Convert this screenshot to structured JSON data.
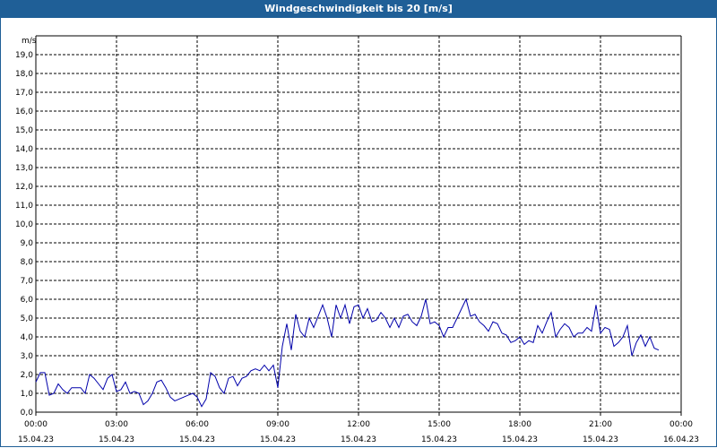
{
  "window": {
    "title": "Windgeschwindigkeit bis 20 [m/s]"
  },
  "chart_data": {
    "type": "line",
    "title": "Windgeschwindigkeit bis 20 [m/s]",
    "ylabel": "m/s",
    "ylim": [
      0,
      20
    ],
    "yticks": [
      "0,0",
      "1,0",
      "2,0",
      "3,0",
      "4,0",
      "5,0",
      "6,0",
      "7,0",
      "8,0",
      "9,0",
      "10,0",
      "11,0",
      "12,0",
      "13,0",
      "14,0",
      "15,0",
      "16,0",
      "17,0",
      "18,0",
      "19,0"
    ],
    "xlim": [
      "2023-04-15 00:00",
      "2023-04-16 00:00"
    ],
    "xticks": [
      {
        "time": "00:00",
        "date": "15.04.23"
      },
      {
        "time": "03:00",
        "date": "15.04.23"
      },
      {
        "time": "06:00",
        "date": "15.04.23"
      },
      {
        "time": "09:00",
        "date": "15.04.23"
      },
      {
        "time": "12:00",
        "date": "15.04.23"
      },
      {
        "time": "15:00",
        "date": "15.04.23"
      },
      {
        "time": "18:00",
        "date": "15.04.23"
      },
      {
        "time": "21:00",
        "date": "15.04.23"
      },
      {
        "time": "00:00",
        "date": "16.04.23"
      }
    ],
    "grid": true,
    "line_color": "#0000aa",
    "x": [
      "00:00",
      "00:10",
      "00:20",
      "00:30",
      "00:40",
      "00:50",
      "01:00",
      "01:10",
      "01:20",
      "01:30",
      "01:40",
      "01:50",
      "02:00",
      "02:10",
      "02:20",
      "02:30",
      "02:40",
      "02:50",
      "03:00",
      "03:10",
      "03:20",
      "03:30",
      "03:40",
      "03:50",
      "04:00",
      "04:10",
      "04:20",
      "04:30",
      "04:40",
      "04:50",
      "05:00",
      "05:10",
      "05:20",
      "05:30",
      "05:40",
      "05:50",
      "06:00",
      "06:10",
      "06:20",
      "06:30",
      "06:40",
      "06:50",
      "07:00",
      "07:10",
      "07:20",
      "07:30",
      "07:40",
      "07:50",
      "08:00",
      "08:10",
      "08:20",
      "08:30",
      "08:40",
      "08:50",
      "09:00",
      "09:10",
      "09:20",
      "09:30",
      "09:40",
      "09:50",
      "10:00",
      "10:10",
      "10:20",
      "10:30",
      "10:40",
      "10:50",
      "11:00",
      "11:10",
      "11:20",
      "11:30",
      "11:40",
      "11:50",
      "12:00",
      "12:10",
      "12:20",
      "12:30",
      "12:40",
      "12:50",
      "13:00",
      "13:10",
      "13:20",
      "13:30",
      "13:40",
      "13:50",
      "14:00",
      "14:10",
      "14:20",
      "14:30",
      "14:40",
      "14:50",
      "15:00",
      "15:10",
      "15:20",
      "15:30",
      "15:40",
      "15:50",
      "16:00",
      "16:10",
      "16:20",
      "16:30",
      "16:40",
      "16:50",
      "17:00",
      "17:10",
      "17:20",
      "17:30",
      "17:40",
      "17:50",
      "18:00",
      "18:10",
      "18:20",
      "18:30",
      "18:40",
      "18:50",
      "19:00",
      "19:10",
      "19:20",
      "19:30",
      "19:40",
      "19:50",
      "20:00",
      "20:10",
      "20:20",
      "20:30",
      "20:40",
      "20:50",
      "21:00",
      "21:10",
      "21:20",
      "21:30",
      "21:40",
      "21:50",
      "22:00",
      "22:10",
      "22:20",
      "22:30",
      "22:40",
      "22:50",
      "23:00",
      "23:10",
      "23:20",
      "23:30",
      "23:40",
      "23:50"
    ],
    "series": [
      {
        "values": [
          1.6,
          2.1,
          2.1,
          0.9,
          1.0,
          1.5,
          1.2,
          1.0,
          1.3,
          1.3,
          1.3,
          1.0,
          2.0,
          1.8,
          1.5,
          1.2,
          1.8,
          2.0,
          1.1,
          1.2,
          1.6,
          1.0,
          1.1,
          1.0,
          0.4,
          0.6,
          1.0,
          1.6,
          1.7,
          1.3,
          0.8,
          0.6,
          0.7,
          0.8,
          0.9,
          1.0,
          0.8,
          0.3,
          0.7,
          2.1,
          1.9,
          1.3,
          1.0,
          1.8,
          1.9,
          1.4,
          1.8,
          1.9,
          2.2,
          2.3,
          2.2,
          2.5,
          2.2,
          2.5,
          1.3,
          3.5,
          4.7,
          3.3,
          5.2,
          4.3,
          4.0,
          5.0,
          4.5,
          5.1,
          5.7,
          5.0,
          4.0,
          5.7,
          5.0,
          5.7,
          4.7,
          5.6,
          5.7,
          5.0,
          5.5,
          4.8,
          4.9,
          5.3,
          5.0,
          4.5,
          5.0,
          4.5,
          5.1,
          5.2,
          4.8,
          4.6,
          5.1,
          6.0,
          4.7,
          4.8,
          4.6,
          4.0,
          4.5,
          4.5,
          5.0,
          5.5,
          6.0,
          5.1,
          5.2,
          4.8,
          4.6,
          4.3,
          4.8,
          4.7,
          4.2,
          4.1,
          3.7,
          3.8,
          4.0,
          3.6,
          3.8,
          3.7,
          4.6,
          4.2,
          4.8,
          5.3,
          4.0,
          4.4,
          4.7,
          4.5,
          4.0,
          4.2,
          4.2,
          4.5,
          4.3,
          5.7,
          4.2,
          4.5,
          4.4,
          3.5,
          3.7,
          4.0,
          4.6,
          3.0,
          3.7,
          4.1,
          3.5,
          4.0,
          3.4,
          3.3
        ]
      }
    ]
  }
}
